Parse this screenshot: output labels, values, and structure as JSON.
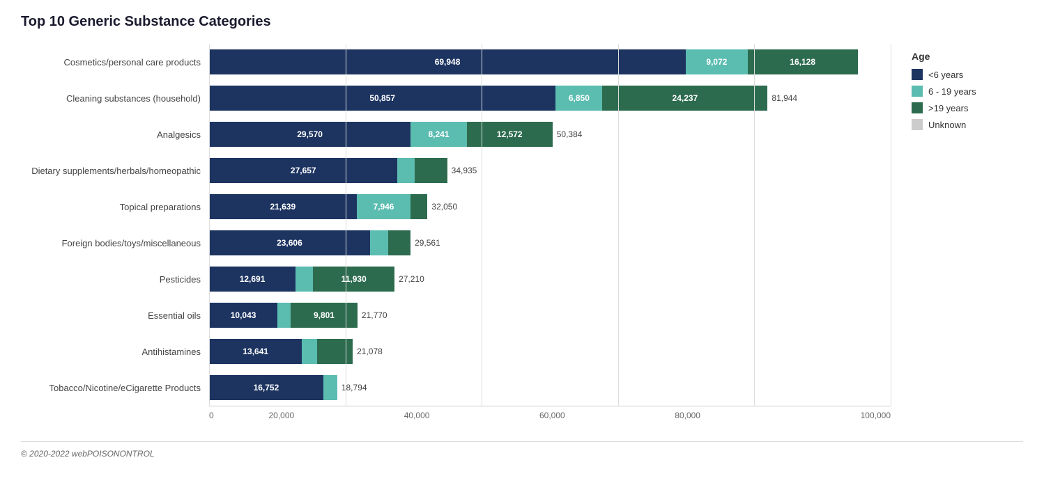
{
  "title": "Top 10 Generic Substance Categories",
  "footer": "© 2020-2022 webPOISONONTROL",
  "colors": {
    "lt6": "#1d3461",
    "age6to19": "#5bbcb0",
    "gt19": "#2d6b4f",
    "unknown": "#cccccc"
  },
  "legend": {
    "title": "Age",
    "items": [
      {
        "label": "<6 years",
        "color_key": "lt6"
      },
      {
        "label": "6 - 19 years",
        "color_key": "age6to19"
      },
      {
        "label": ">19 years",
        "color_key": "gt19"
      },
      {
        "label": "Unknown",
        "color_key": "unknown"
      }
    ]
  },
  "x_axis": {
    "max": 100000,
    "ticks": [
      "0",
      "20,000",
      "40,000",
      "60,000",
      "80,000",
      "100,000"
    ]
  },
  "bars": [
    {
      "label": "Cosmetics/personal care products",
      "segments": [
        {
          "type": "lt6",
          "value": 69948,
          "label": "69,948"
        },
        {
          "type": "age6to19",
          "value": 9072,
          "label": "9,072"
        },
        {
          "type": "gt19",
          "value": 16128,
          "label": "16,128"
        }
      ],
      "total_label": ""
    },
    {
      "label": "Cleaning substances (household)",
      "segments": [
        {
          "type": "lt6",
          "value": 50857,
          "label": "50,857"
        },
        {
          "type": "age6to19",
          "value": 6850,
          "label": "6,850"
        },
        {
          "type": "gt19",
          "value": 24237,
          "label": "24,237"
        }
      ],
      "total_label": "81,944"
    },
    {
      "label": "Analgesics",
      "segments": [
        {
          "type": "lt6",
          "value": 29570,
          "label": "29,570"
        },
        {
          "type": "age6to19",
          "value": 8241,
          "label": "8,241"
        },
        {
          "type": "gt19",
          "value": 12572,
          "label": "12,572"
        }
      ],
      "total_label": "50,384"
    },
    {
      "label": "Dietary supplements/herbals/homeopathic",
      "segments": [
        {
          "type": "lt6",
          "value": 27657,
          "label": "27,657"
        },
        {
          "type": "age6to19",
          "value": 2500,
          "label": ""
        },
        {
          "type": "gt19",
          "value": 4778,
          "label": ""
        }
      ],
      "total_label": "34,935"
    },
    {
      "label": "Topical preparations",
      "segments": [
        {
          "type": "lt6",
          "value": 21639,
          "label": "21,639"
        },
        {
          "type": "age6to19",
          "value": 7946,
          "label": "7,946"
        },
        {
          "type": "gt19",
          "value": 2465,
          "label": ""
        }
      ],
      "total_label": "32,050"
    },
    {
      "label": "Foreign bodies/toys/miscellaneous",
      "segments": [
        {
          "type": "lt6",
          "value": 23606,
          "label": "23,606"
        },
        {
          "type": "age6to19",
          "value": 2700,
          "label": ""
        },
        {
          "type": "gt19",
          "value": 3255,
          "label": ""
        }
      ],
      "total_label": "29,561"
    },
    {
      "label": "Pesticides",
      "segments": [
        {
          "type": "lt6",
          "value": 12691,
          "label": "12,691"
        },
        {
          "type": "age6to19",
          "value": 2589,
          "label": ""
        },
        {
          "type": "gt19",
          "value": 11930,
          "label": "11,930"
        }
      ],
      "total_label": "27,210"
    },
    {
      "label": "Essential oils",
      "segments": [
        {
          "type": "lt6",
          "value": 10043,
          "label": "10,043"
        },
        {
          "type": "age6to19",
          "value": 1926,
          "label": ""
        },
        {
          "type": "gt19",
          "value": 9801,
          "label": "9,801"
        }
      ],
      "total_label": "21,770"
    },
    {
      "label": "Antihistamines",
      "segments": [
        {
          "type": "lt6",
          "value": 13641,
          "label": "13,641"
        },
        {
          "type": "age6to19",
          "value": 2200,
          "label": ""
        },
        {
          "type": "gt19",
          "value": 5237,
          "label": ""
        }
      ],
      "total_label": "21,078"
    },
    {
      "label": "Tobacco/Nicotine/eCigarette Products",
      "segments": [
        {
          "type": "lt6",
          "value": 16752,
          "label": "16,752"
        },
        {
          "type": "age6to19",
          "value": 2042,
          "label": ""
        },
        {
          "type": "gt19",
          "value": 0,
          "label": ""
        }
      ],
      "total_label": "18,794"
    }
  ]
}
